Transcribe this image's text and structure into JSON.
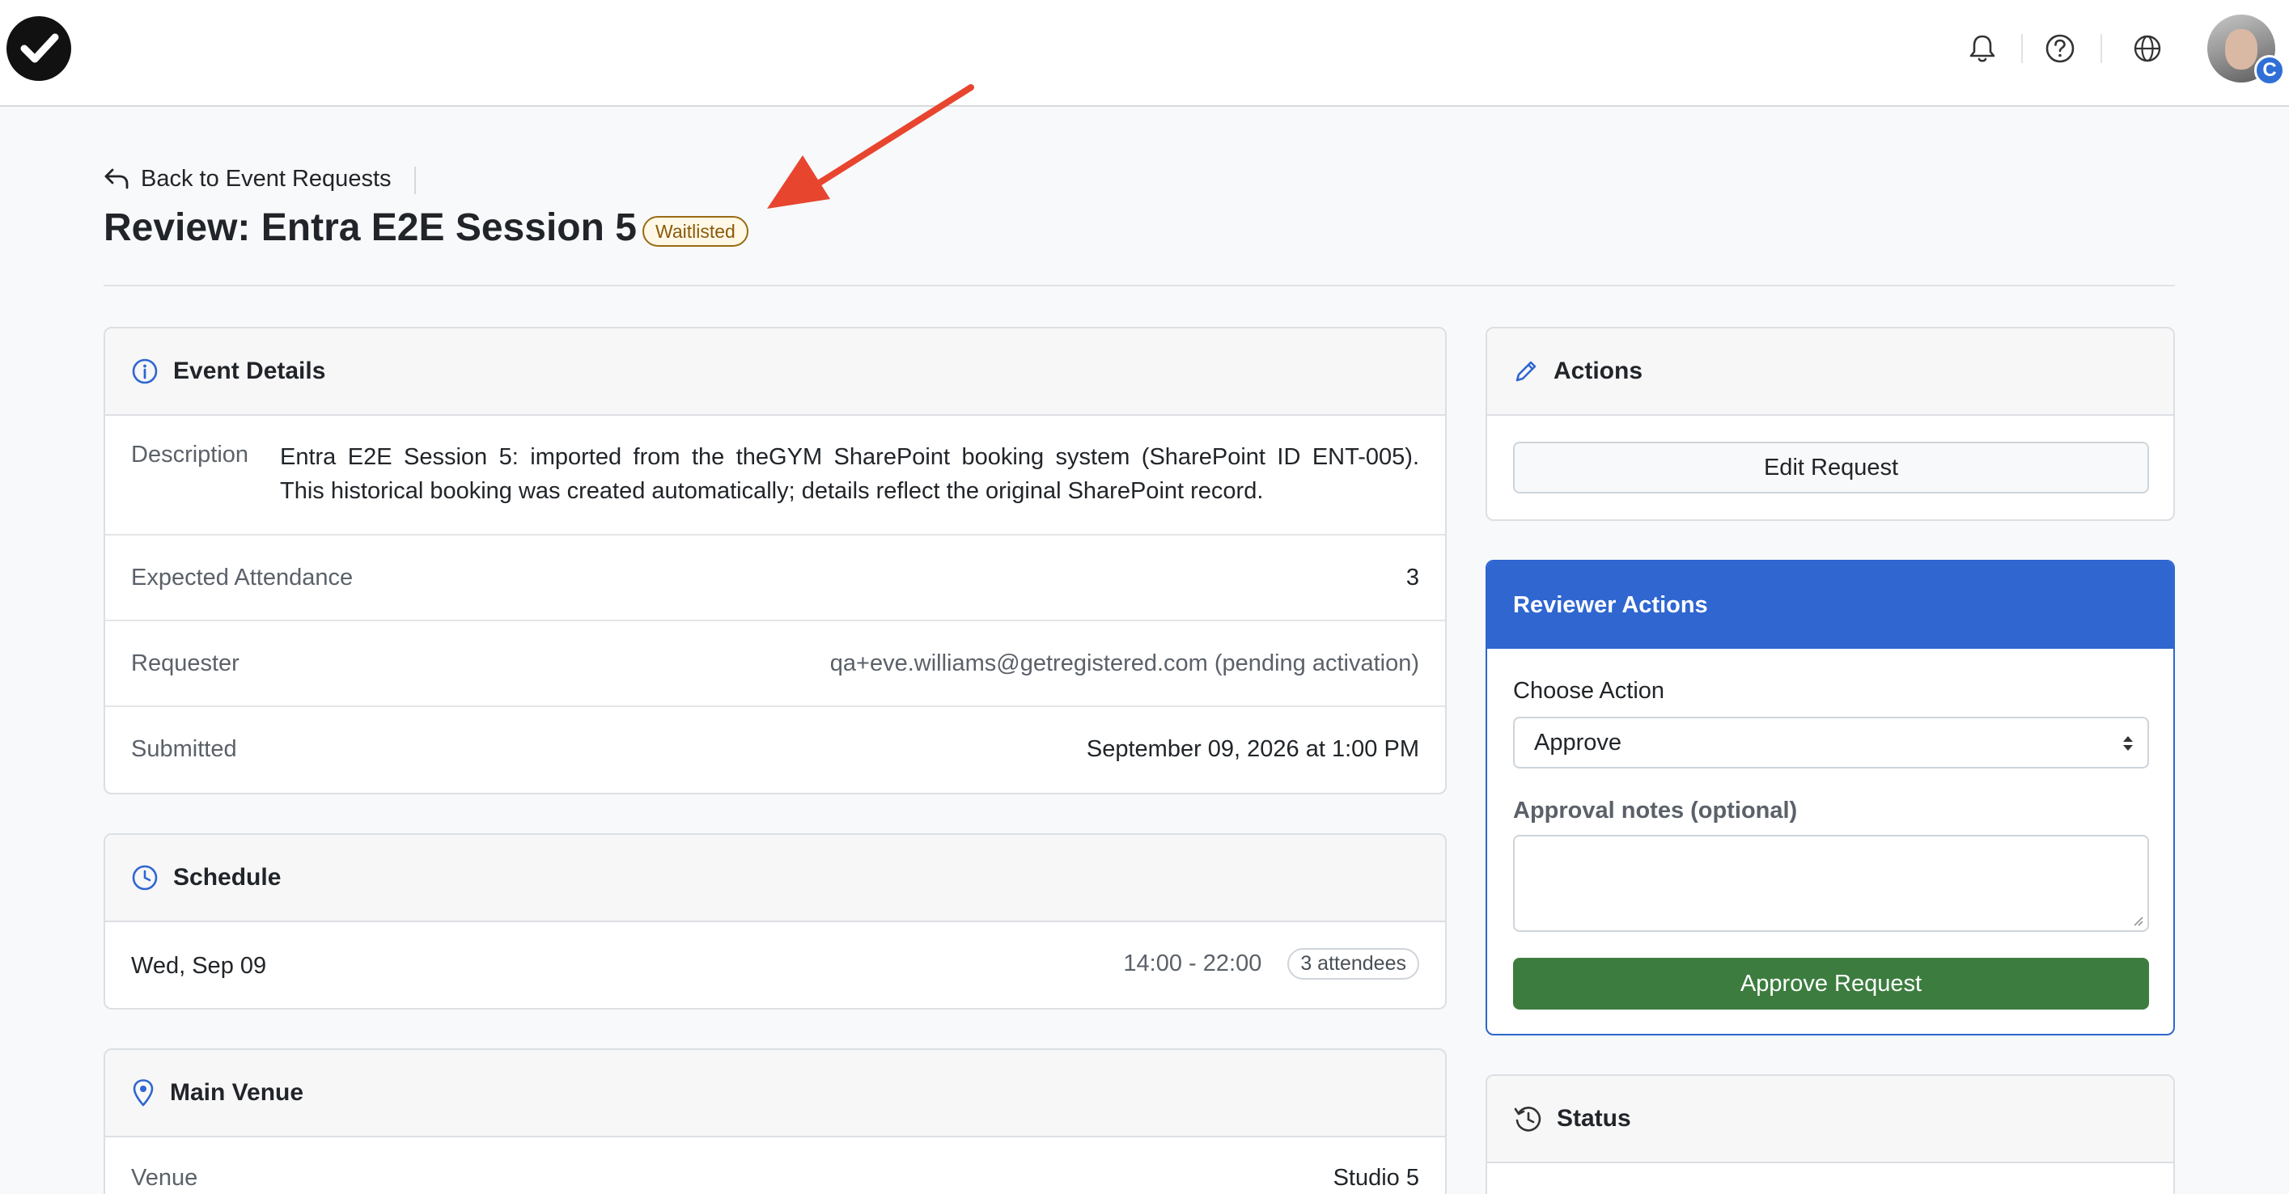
{
  "nav": {
    "icons": [
      "checkmark-logo-icon",
      "bell-icon",
      "help-circle-icon",
      "globe-icon"
    ],
    "avatar_badge": "C"
  },
  "back_link": {
    "label": "Back to Event Requests"
  },
  "page": {
    "title": "Review: Entra E2E Session 5",
    "status_badge": "Waitlisted"
  },
  "event_details": {
    "header": "Event Details",
    "description_label": "Description",
    "description_line1": "Entra E2E Session 5: imported from the theGYM SharePoint booking system (SharePoint ID ENT-005).",
    "description_line2": "This historical booking was created automatically; details reflect the original SharePoint record.",
    "attendance_label": "Expected Attendance",
    "attendance_value": "3",
    "requester_label": "Requester",
    "requester_value": "qa+eve.williams@getregistered.com (pending activation)",
    "submitted_label": "Submitted",
    "submitted_value": "September 09, 2026 at 1:00 PM"
  },
  "schedule": {
    "header": "Schedule",
    "date": "Wed, Sep 09",
    "time": "14:00 - 22:00",
    "attendees": "3 attendees"
  },
  "venue": {
    "header": "Main Venue",
    "venue_label": "Venue",
    "venue_value": "Studio 5"
  },
  "actions": {
    "header": "Actions",
    "edit_label": "Edit Request"
  },
  "reviewer": {
    "header": "Reviewer Actions",
    "choose_label": "Choose Action",
    "selected_action": "Approve",
    "notes_label": "Approval notes (optional)",
    "approve_button": "Approve Request"
  },
  "status_card": {
    "header": "Status"
  },
  "colors": {
    "accent": "#2f66d0",
    "approve": "#3c7d3f",
    "waitlisted": "#8a5a0a",
    "annotation_arrow": "#e8452f"
  }
}
